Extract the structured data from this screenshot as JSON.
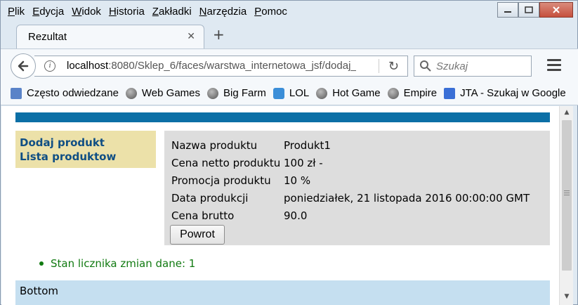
{
  "menu": [
    "Plik",
    "Edycja",
    "Widok",
    "Historia",
    "Zakładki",
    "Narzędzia",
    "Pomoc"
  ],
  "tab": {
    "title": "Rezultat"
  },
  "address": {
    "host": "localhost",
    "rest": ":8080/Sklep_6/faces/warstwa_internetowa_jsf/dodaj_p"
  },
  "search": {
    "placeholder": "Szukaj"
  },
  "bookmarks": [
    {
      "label": "Często odwiedzane",
      "icon": "page-icon"
    },
    {
      "label": "Web Games",
      "icon": "globe-icon"
    },
    {
      "label": "Big Farm",
      "icon": "globe-icon"
    },
    {
      "label": "LOL",
      "icon": "lol-icon"
    },
    {
      "label": "Hot Game",
      "icon": "globe-icon"
    },
    {
      "label": "Empire",
      "icon": "globe-icon"
    },
    {
      "label": "JTA - Szukaj w Google",
      "icon": "jta-icon"
    }
  ],
  "sidebar": {
    "links": [
      "Dodaj produkt",
      "Lista produktow"
    ]
  },
  "product": {
    "rows": [
      {
        "label": "Nazwa produktu",
        "value": "Produkt1"
      },
      {
        "label": "Cena netto produktu",
        "value": "100 zł -"
      },
      {
        "label": "Promocja produktu",
        "value": "10 %"
      },
      {
        "label": "Data produkcji",
        "value": "poniedziałek, 21 listopada 2016 00:00:00 GMT"
      },
      {
        "label": "Cena brutto",
        "value": "90.0"
      }
    ],
    "back_label": "Powrot"
  },
  "message": "Stan licznika zmian dane: 1",
  "footer": "Bottom",
  "colors": {
    "top_stripe": "#0c6fa6",
    "sidebar_bg": "#ece1a9",
    "link": "#0f4e84",
    "panel_bg": "#dddddd",
    "message": "#117a11",
    "footer_bg": "#c5dff0"
  }
}
